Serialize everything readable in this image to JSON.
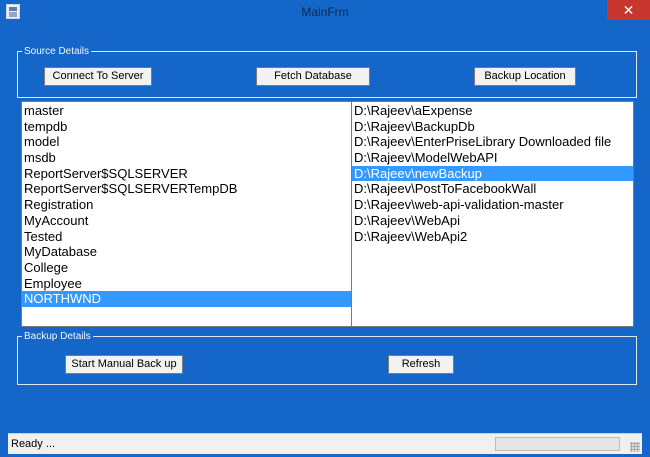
{
  "window": {
    "title": "MainFrm",
    "close_glyph": "✕"
  },
  "source_details": {
    "legend": "Source Details",
    "connect_label": "Connect To Server",
    "fetch_label": "Fetch Database",
    "backup_location_label": "Backup Location"
  },
  "databases": {
    "items": [
      "master",
      "tempdb",
      "model",
      "msdb",
      "ReportServer$SQLSERVER",
      "ReportServer$SQLSERVERTempDB",
      "Registration",
      "MyAccount",
      "Tested",
      "MyDatabase",
      "College",
      "Employee",
      "NORTHWND"
    ],
    "selected": "NORTHWND"
  },
  "folders": {
    "items": [
      "D:\\Rajeev\\aExpense",
      "D:\\Rajeev\\BackupDb",
      "D:\\Rajeev\\EnterPriseLibrary Downloaded file",
      "D:\\Rajeev\\ModelWebAPI",
      "D:\\Rajeev\\newBackup",
      "D:\\Rajeev\\PostToFacebookWall",
      "D:\\Rajeev\\web-api-validation-master",
      "D:\\Rajeev\\WebApi",
      "D:\\Rajeev\\WebApi2"
    ],
    "selected": "D:\\Rajeev\\newBackup"
  },
  "backup_details": {
    "legend": "Backup Details",
    "manual_label": "Start Manual Back up",
    "refresh_label": "Refresh"
  },
  "status": {
    "text": "Ready ...",
    "progress": 0
  },
  "colors": {
    "window_bg": "#1466c8",
    "selection": "#3399ff",
    "close": "#c7372f"
  },
  "icons": {
    "app": "app-window-icon",
    "close": "close-icon",
    "grip": "resize-grip-icon"
  }
}
